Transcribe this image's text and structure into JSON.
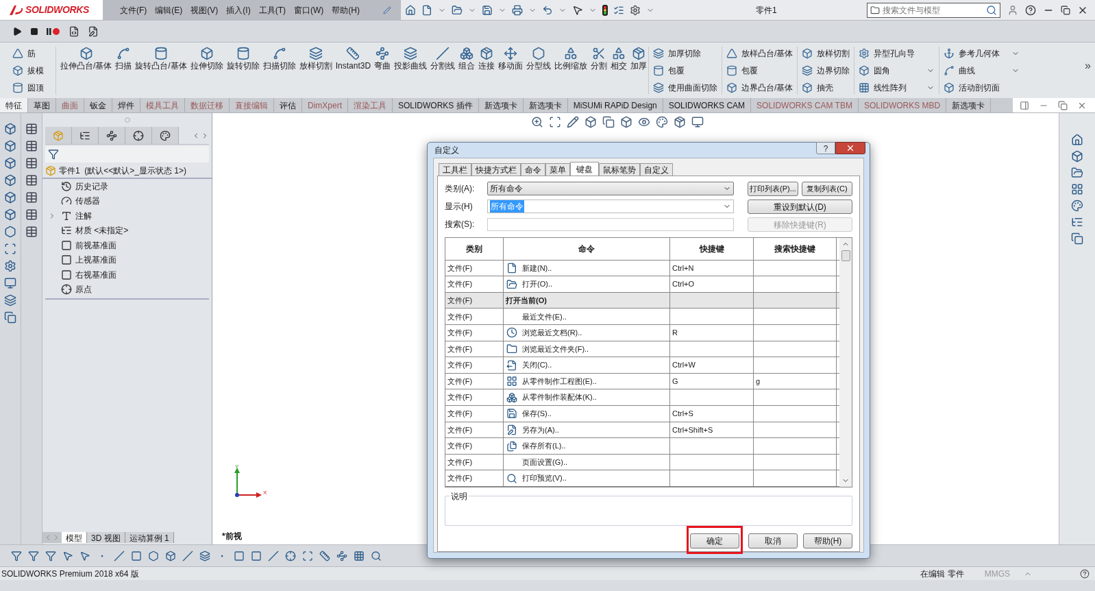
{
  "app": {
    "logo": "SOLIDWORKS"
  },
  "menu": [
    "文件(F)",
    "编辑(E)",
    "视图(V)",
    "插入(I)",
    "工具(T)",
    "窗口(W)",
    "帮助(H)"
  ],
  "window": {
    "title": "零件1"
  },
  "search": {
    "placeholder": "搜索文件与模型"
  },
  "ribbon": {
    "stacked_left": [
      "筋",
      "拔模",
      "圆顶"
    ],
    "large": [
      "拉伸凸台/基体",
      "扫描",
      "旋转凸台/基体",
      "拉伸切除",
      "旋转切除",
      "扫描切除",
      "放样切割",
      "Instant3D",
      "弯曲",
      "投影曲线",
      "分割线",
      "组合",
      "连接",
      "移动面",
      "分型线",
      "比例缩放",
      "分割",
      "相交",
      "加厚"
    ],
    "columns": [
      [
        {
          "label": "加厚切除",
          "menu": false
        },
        {
          "label": "包覆",
          "menu": false
        },
        {
          "label": "使用曲面切除",
          "menu": false
        }
      ],
      [
        {
          "label": "放样凸台/基体",
          "menu": false
        },
        {
          "label": "包覆",
          "menu": false
        },
        {
          "label": "边界凸台/基体",
          "menu": false
        }
      ],
      [
        {
          "label": "放样切割",
          "menu": false
        },
        {
          "label": "边界切除",
          "menu": false
        },
        {
          "label": "抽壳",
          "menu": false
        }
      ],
      [
        {
          "label": "异型孔向导",
          "menu": false
        },
        {
          "label": "圆角",
          "menu": true
        },
        {
          "label": "线性阵列",
          "menu": true
        }
      ],
      [
        {
          "label": "参考几何体",
          "menu": true
        },
        {
          "label": "曲线",
          "menu": true
        },
        {
          "label": "活动剖切面",
          "menu": false
        }
      ]
    ],
    "more": "»"
  },
  "ribbon_tabs": [
    {
      "label": "特征",
      "selected": true,
      "dimmed": false
    },
    {
      "label": "草图",
      "selected": false,
      "dimmed": false
    },
    {
      "label": "曲面",
      "selected": false,
      "dimmed": true
    },
    {
      "label": "钣金",
      "selected": false,
      "dimmed": false
    },
    {
      "label": "焊件",
      "selected": false,
      "dimmed": false
    },
    {
      "label": "模具工具",
      "selected": false,
      "dimmed": true
    },
    {
      "label": "数据迁移",
      "selected": false,
      "dimmed": true
    },
    {
      "label": "直接编辑",
      "selected": false,
      "dimmed": true
    },
    {
      "label": "评估",
      "selected": false,
      "dimmed": false
    },
    {
      "label": "DimXpert",
      "selected": false,
      "dimmed": true
    },
    {
      "label": "渲染工具",
      "selected": false,
      "dimmed": true
    },
    {
      "label": "SOLIDWORKS 插件",
      "selected": false,
      "dimmed": false
    },
    {
      "label": "新选项卡",
      "selected": false,
      "dimmed": false
    },
    {
      "label": "新选项卡",
      "selected": false,
      "dimmed": false
    },
    {
      "label": "MiSUMi RAPiD Design",
      "selected": false,
      "dimmed": false
    },
    {
      "label": "SOLIDWORKS CAM",
      "selected": false,
      "dimmed": false
    },
    {
      "label": "SOLIDWORKS CAM TBM",
      "selected": false,
      "dimmed": true
    },
    {
      "label": "SOLIDWORKS MBD",
      "selected": false,
      "dimmed": true
    },
    {
      "label": "新选项卡",
      "selected": false,
      "dimmed": false
    }
  ],
  "feature_tree": {
    "root": "零件1  (默认<<默认>_显示状态 1>)",
    "items": [
      {
        "label": "历史记录",
        "kind": "history",
        "expandable": false
      },
      {
        "label": "传感器",
        "kind": "sensor",
        "expandable": false
      },
      {
        "label": "注解",
        "kind": "annotation",
        "expandable": true
      },
      {
        "label": "材质 <未指定>",
        "kind": "material",
        "expandable": false
      },
      {
        "label": "前视基准面",
        "kind": "plane",
        "expandable": false
      },
      {
        "label": "上视基准面",
        "kind": "plane",
        "expandable": false
      },
      {
        "label": "右视基准面",
        "kind": "plane",
        "expandable": false
      },
      {
        "label": "原点",
        "kind": "origin",
        "expandable": false
      }
    ]
  },
  "view_tabs": [
    {
      "label": "模型",
      "selected": true
    },
    {
      "label": "3D 视图",
      "selected": false
    },
    {
      "label": "运动算例 1",
      "selected": false
    }
  ],
  "viewport": {
    "view_label": "*前视",
    "axes": [
      "Y",
      "X"
    ]
  },
  "dialog": {
    "title": "自定义",
    "help": "?",
    "tabs": [
      {
        "label": "工具栏",
        "selected": false
      },
      {
        "label": "快捷方式栏",
        "selected": false
      },
      {
        "label": "命令",
        "selected": false
      },
      {
        "label": "菜单",
        "selected": false
      },
      {
        "label": "键盘",
        "selected": true
      },
      {
        "label": "鼠标笔势",
        "selected": false
      },
      {
        "label": "自定义",
        "selected": false
      }
    ],
    "category": {
      "label": "类别(A):",
      "value": "所有命令"
    },
    "display": {
      "label": "显示(H)",
      "value": "所有命令"
    },
    "search": {
      "label": "搜索(S):"
    },
    "side_buttons": [
      {
        "label": "打印列表(P)...",
        "disabled": false
      },
      {
        "label": "复制列表(C)",
        "disabled": false
      },
      {
        "label": "重设到默认(D)",
        "disabled": false
      },
      {
        "label": "移除快捷键(R)",
        "disabled": true
      }
    ],
    "columns": [
      "类别",
      "命令",
      "快捷键",
      "搜索快捷键"
    ],
    "rows": [
      {
        "kind": "command",
        "category": "文件(F)",
        "command": "新建(N)..",
        "shortcut": "Ctrl+N",
        "search_shortcut": ""
      },
      {
        "kind": "command",
        "category": "文件(F)",
        "command": "打开(O)..",
        "shortcut": "Ctrl+O",
        "search_shortcut": ""
      },
      {
        "kind": "group",
        "category": "文件(F)",
        "command": "打开当前(O)",
        "shortcut": "",
        "search_shortcut": ""
      },
      {
        "kind": "command",
        "category": "文件(F)",
        "command": "最近文件(E)..",
        "shortcut": "",
        "search_shortcut": ""
      },
      {
        "kind": "command",
        "category": "文件(F)",
        "command": "浏览最近文档(R)..",
        "shortcut": "R",
        "search_shortcut": ""
      },
      {
        "kind": "command",
        "category": "文件(F)",
        "command": "浏览最近文件夹(F)..",
        "shortcut": "",
        "search_shortcut": ""
      },
      {
        "kind": "command",
        "category": "文件(F)",
        "command": "关闭(C)..",
        "shortcut": "Ctrl+W",
        "search_shortcut": ""
      },
      {
        "kind": "command",
        "category": "文件(F)",
        "command": "从零件制作工程图(E)..",
        "shortcut": "G",
        "search_shortcut": "g"
      },
      {
        "kind": "command",
        "category": "文件(F)",
        "command": "从零件制作装配体(K)..",
        "shortcut": "",
        "search_shortcut": ""
      },
      {
        "kind": "command",
        "category": "文件(F)",
        "command": "保存(S)..",
        "shortcut": "Ctrl+S",
        "search_shortcut": ""
      },
      {
        "kind": "command",
        "category": "文件(F)",
        "command": "另存为(A)..",
        "shortcut": "Ctrl+Shift+S",
        "search_shortcut": ""
      },
      {
        "kind": "command",
        "category": "文件(F)",
        "command": "保存所有(L)..",
        "shortcut": "",
        "search_shortcut": ""
      },
      {
        "kind": "command",
        "category": "文件(F)",
        "command": "页面设置(G)..",
        "shortcut": "",
        "search_shortcut": ""
      },
      {
        "kind": "command",
        "category": "文件(F)",
        "command": "打印预览(V)..",
        "shortcut": "",
        "search_shortcut": ""
      }
    ],
    "description_label": "说明",
    "footer_buttons": [
      {
        "label": "确定",
        "highlighted": true
      },
      {
        "label": "取消",
        "highlighted": false
      },
      {
        "label": "帮助(H)",
        "highlighted": false
      }
    ]
  },
  "status_bar": {
    "product": "SOLIDWORKS Premium 2018 x64 版",
    "mode": "在编辑 零件",
    "units": "MMGS"
  }
}
